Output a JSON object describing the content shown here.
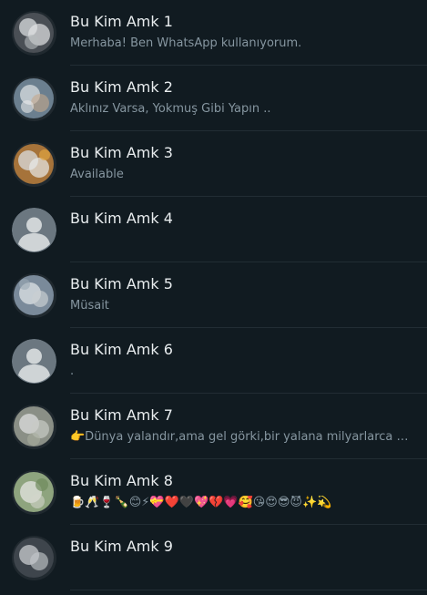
{
  "contacts": [
    {
      "name": "Bu Kim Amk 1",
      "status": "Merhaba! Ben WhatsApp kullanıyorum.",
      "avatar": "blurred-photo",
      "avatar_color": "#4a4f55"
    },
    {
      "name": "Bu Kim Amk 2",
      "status": "Aklınız Varsa, Yokmuş Gibi Yapın ..",
      "avatar": "blurred-photo",
      "avatar_color": "#6b7f8f"
    },
    {
      "name": "Bu Kim Amk 3",
      "status": "Available",
      "avatar": "blurred-photo",
      "avatar_color": "#a6733a"
    },
    {
      "name": "Bu Kim Amk 4",
      "status": "",
      "avatar": "default-person",
      "avatar_color": "#6b7780"
    },
    {
      "name": "Bu Kim Amk 5",
      "status": "Müsait",
      "avatar": "blurred-photo",
      "avatar_color": "#7a8a9a"
    },
    {
      "name": "Bu Kim Amk 6",
      "status": ".",
      "avatar": "default-person",
      "avatar_color": "#6b7780"
    },
    {
      "name": "Bu Kim Amk 7",
      "status": "👉Dünya yalandır,ama gel görki,bir yalana milyarlarca insan inanır",
      "avatar": "blurred-photo",
      "avatar_color": "#8a8f86"
    },
    {
      "name": "Bu Kim Amk 8",
      "status": "🍺🥂🍷🍾😊⚡💝❤️🖤💖💔💗🥰😘😍😎😈✨💫",
      "avatar": "blurred-photo",
      "avatar_color": "#8ea47e"
    },
    {
      "name": "Bu Kim Amk 9",
      "status": "",
      "avatar": "blurred-photo",
      "avatar_color": "#3e454c"
    }
  ]
}
